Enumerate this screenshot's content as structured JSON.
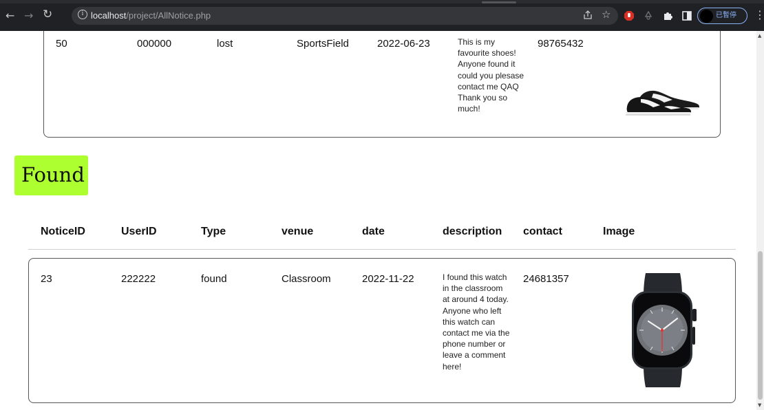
{
  "browser": {
    "url_host": "localhost",
    "url_path": "/project/AllNotice.php",
    "profile_label": "已暫停"
  },
  "lost_notice": {
    "notice_id": "50",
    "user_id": "000000",
    "type": "lost",
    "venue": "SportsField",
    "date": "2022-06-23",
    "description_lines": [
      "This is my",
      "favourite shoes!",
      "Anyone found it",
      "could you plesase",
      "contact me QAQ",
      "Thank you so",
      "much!"
    ],
    "contact": "98765432",
    "image_icon": "sneaker-icon"
  },
  "found_section": {
    "heading": "Found",
    "heading_bg": "#adff2f",
    "columns": [
      "NoticeID",
      "UserID",
      "Type",
      "venue",
      "date",
      "description",
      "contact",
      "Image"
    ],
    "rows": [
      {
        "notice_id": "23",
        "user_id": "222222",
        "type": "found",
        "venue": "Classroom",
        "date": "2022-11-22",
        "description_lines": [
          "I found this watch",
          "in the classroom",
          "at around 4 today.",
          "Anyone who left",
          "this watch can",
          "contact me via the",
          "phone number or",
          "leave a comment",
          "here!"
        ],
        "contact": "24681357",
        "image_icon": "smartwatch-icon"
      }
    ]
  }
}
